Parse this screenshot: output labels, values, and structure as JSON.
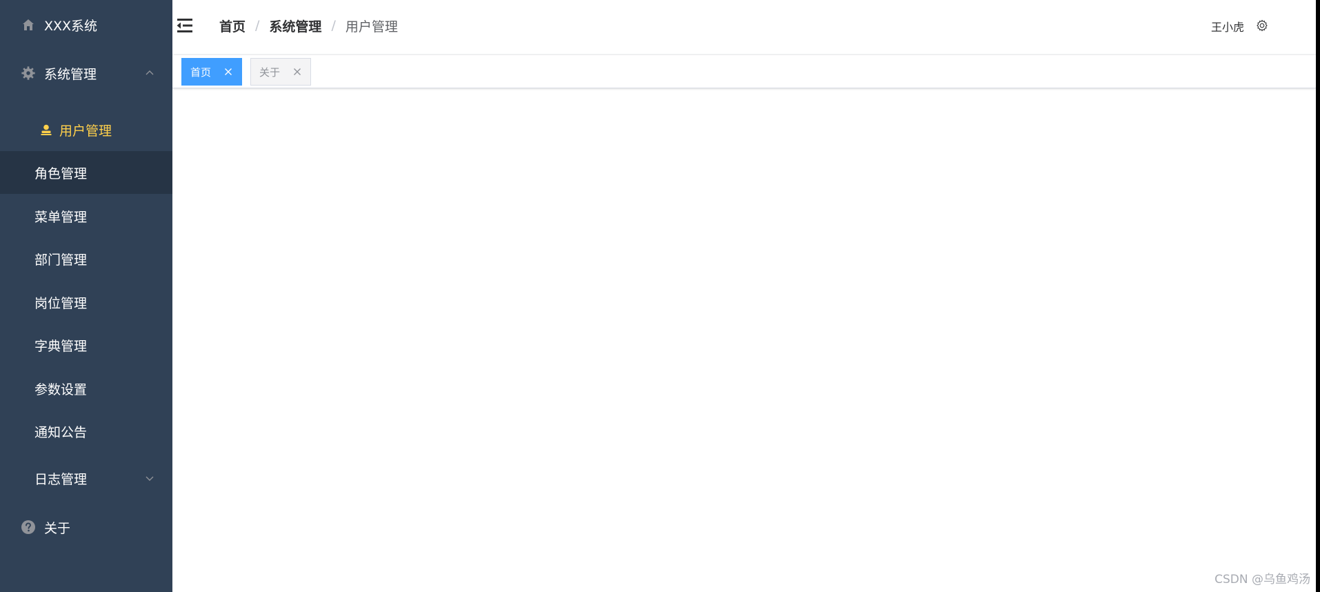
{
  "sidebar": {
    "brand": {
      "label": "XXX系统",
      "icon": "home-icon"
    },
    "system_menu": {
      "label": "系统管理",
      "icon": "gear-icon",
      "expanded": true
    },
    "items": [
      {
        "label": "用户管理",
        "icon": "user-icon",
        "active": true
      },
      {
        "label": "角色管理",
        "hover": true
      },
      {
        "label": "菜单管理"
      },
      {
        "label": "部门管理"
      },
      {
        "label": "岗位管理"
      },
      {
        "label": "字典管理"
      },
      {
        "label": "参数设置"
      },
      {
        "label": "通知公告"
      },
      {
        "label": "日志管理",
        "collapsed": true
      }
    ],
    "about": {
      "label": "关于",
      "icon": "question-icon"
    }
  },
  "header": {
    "breadcrumb": [
      "首页",
      "系统管理",
      "用户管理"
    ],
    "separator": "/",
    "user_name": "王小虎"
  },
  "tags": [
    {
      "label": "首页",
      "active": true
    },
    {
      "label": "关于",
      "active": false
    }
  ],
  "watermark": "CSDN @乌鱼鸡汤",
  "colors": {
    "sidebar_bg": "#304156",
    "active_text": "#ffd04b",
    "tag_active": "#409eff"
  }
}
